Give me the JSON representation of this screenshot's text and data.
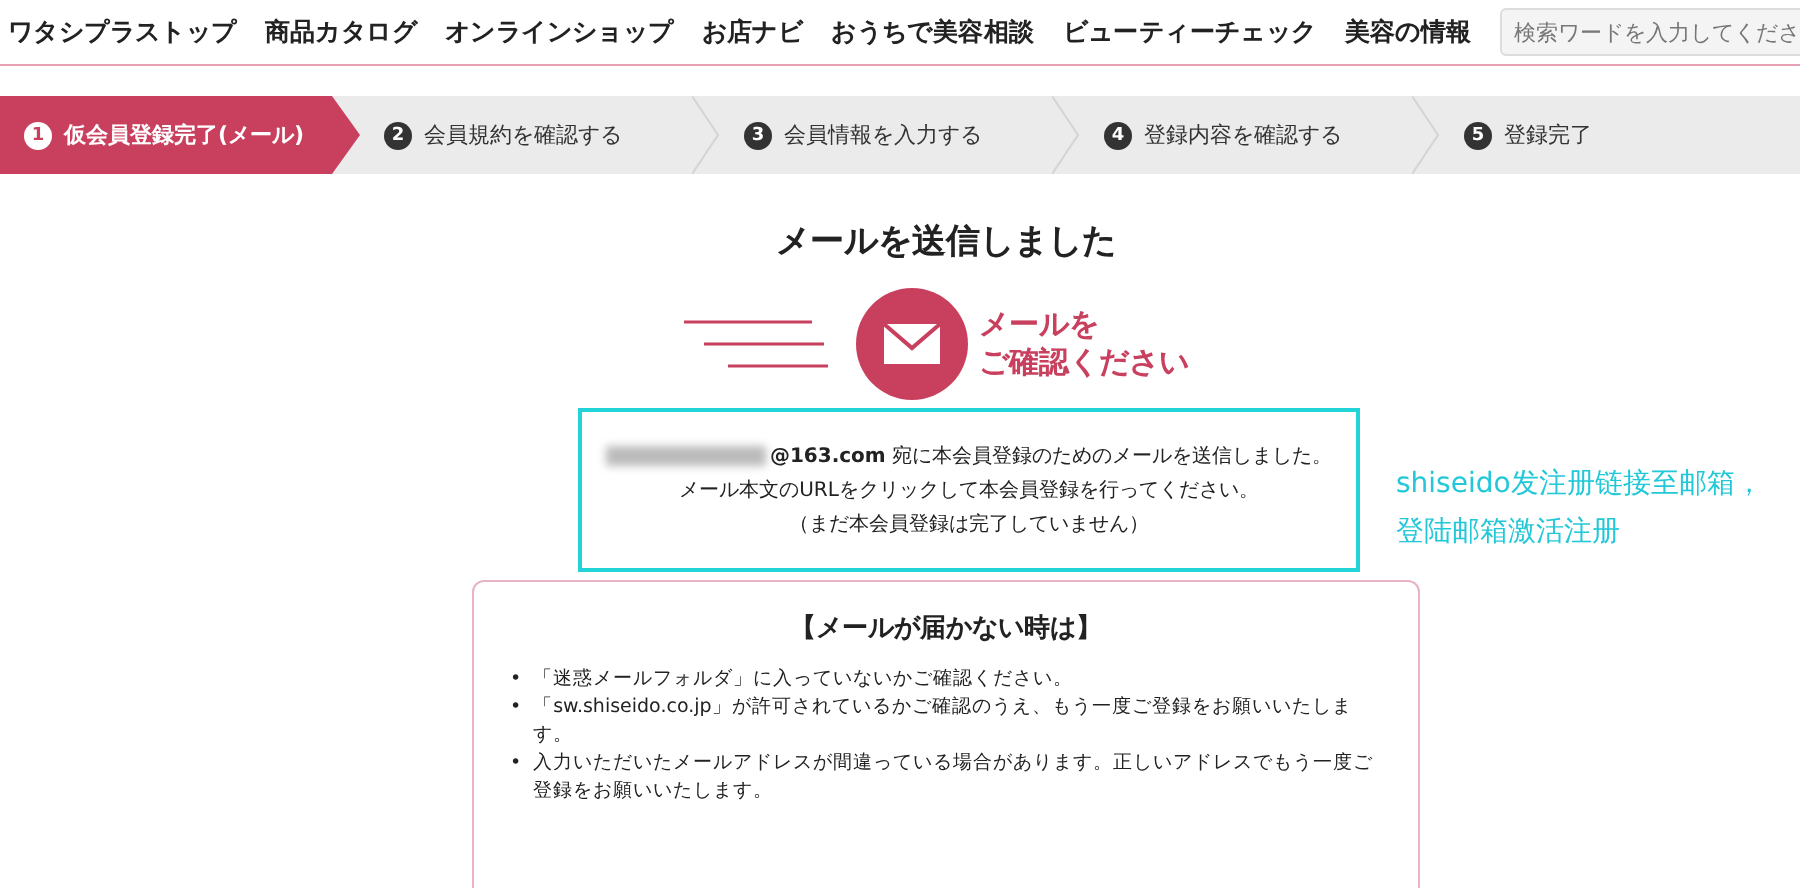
{
  "nav": {
    "items": [
      "ワタシプラストップ",
      "商品カタログ",
      "オンラインショップ",
      "お店ナビ",
      "おうちで美容相談",
      "ビューティーチェック",
      "美容の情報"
    ],
    "search": {
      "placeholder": "検索ワードを入力してくださ"
    }
  },
  "steps": [
    {
      "number": "1",
      "label": "仮会員登録完了(メール)",
      "selected": true
    },
    {
      "number": "2",
      "label": "会員規約を確認する",
      "selected": false
    },
    {
      "number": "3",
      "label": "会員情報を入力する",
      "selected": false
    },
    {
      "number": "4",
      "label": "登録内容を確認する",
      "selected": false
    },
    {
      "number": "5",
      "label": "登録完了",
      "selected": false
    }
  ],
  "heading": "メールを送信しました",
  "mail_badge": {
    "lines": [
      "メールを",
      "ご確認ください"
    ]
  },
  "message": [
    "**@163.com** 宛に本会員登録のためのメールを送信しました。",
    "メール本文のURLをクリックして本会員登録を行ってください。",
    "（まだ本会員登録は完了していません）"
  ],
  "annotation": "shiseido发注册链接至邮箱，登陆邮箱激活注册",
  "help": {
    "title": "【メールが届かない時は】",
    "marker": "•",
    "items": [
      "「迷惑メールフォルダ」に入っていないかご確認ください。",
      "「sw.shiseido.co.jp」が許可されているかご確認のうえ、もう一度ご登録をお願いいたします。",
      "入力いただいたメールアドレスが間違っている場合があります。正しいアドレスでもう一度ご登録をお願いいたします。"
    ]
  }
}
